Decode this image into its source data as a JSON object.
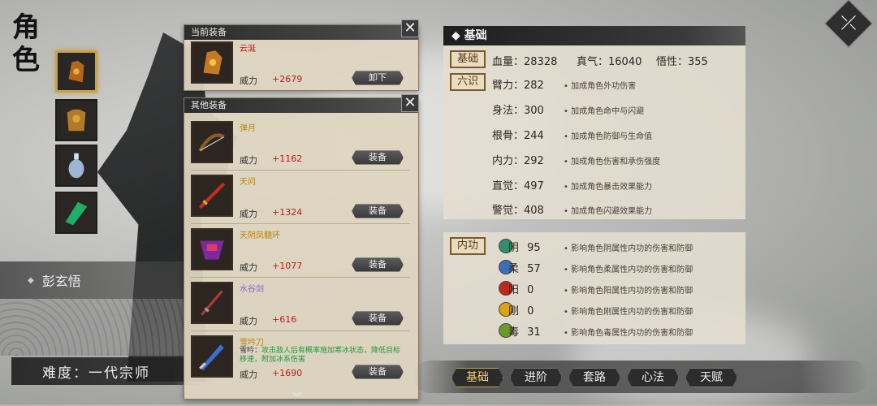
{
  "page": {
    "title": "角色"
  },
  "character": {
    "name": "彭玄悟",
    "difficulty": "难度：一代宗师"
  },
  "equip_slots": [
    {
      "name": "gauntlet",
      "selected": true
    },
    {
      "name": "armor",
      "selected": false
    },
    {
      "name": "pendant",
      "selected": false
    },
    {
      "name": "jade",
      "selected": false
    }
  ],
  "current_equipment": {
    "header": "当前装备",
    "item": {
      "name": "云涎",
      "power_label": "威力",
      "power_value": "+2679",
      "button": "卸下"
    }
  },
  "other_equipment": {
    "header": "其他装备",
    "items": [
      {
        "name": "弹月",
        "power_label": "威力",
        "power_value": "+1162",
        "button": "装备",
        "name_color": "#b8860b"
      },
      {
        "name": "天问",
        "power_label": "威力",
        "power_value": "+1324",
        "button": "装备",
        "name_color": "#b8860b"
      },
      {
        "name": "天阴凤髓环",
        "power_label": "威力",
        "power_value": "+1077",
        "button": "装备",
        "name_color": "#b8860b"
      },
      {
        "name": "水谷剑",
        "power_label": "威力",
        "power_value": "+616",
        "button": "装备",
        "name_color": "#8a5ad6"
      },
      {
        "name": "雪吟刀",
        "power_label": "威力",
        "power_value": "+1690",
        "button": "装备",
        "name_color": "#b8860b",
        "desc_prefix": "雪吟：",
        "desc": "攻击敌人后有概率施加寒冰状态，降低目标移速，附加冰系伤害"
      }
    ]
  },
  "stats": {
    "header": "基础",
    "tag_basic": "基础",
    "tag_six": "六识",
    "hp_label": "血量：",
    "hp_value": "28328",
    "qi_label": "真气：",
    "qi_value": "16040",
    "wux_label": "悟性：",
    "wux_value": "355",
    "rows": [
      {
        "label": "臂力：",
        "value": "282",
        "desc": "加成角色外功伤害"
      },
      {
        "label": "身法：",
        "value": "300",
        "desc": "加成角色命中与闪避"
      },
      {
        "label": "根骨：",
        "value": "244",
        "desc": "加成角色防御与生命值"
      },
      {
        "label": "内力：",
        "value": "292",
        "desc": "加成角色伤害和承伤强度"
      },
      {
        "label": "直觉：",
        "value": "497",
        "desc": "加成角色暴击效果能力"
      },
      {
        "label": "警觉：",
        "value": "408",
        "desc": "加成角色闪避效果能力"
      }
    ]
  },
  "neigong": {
    "tag": "内功",
    "rows": [
      {
        "char": "阴",
        "value": "95",
        "desc": "影响角色阴属性内功的伤害和防御",
        "color": "#2f8f6a"
      },
      {
        "char": "柔",
        "value": "57",
        "desc": "影响角色柔属性内功的伤害和防御",
        "color": "#3a6fb8"
      },
      {
        "char": "阳",
        "value": "0",
        "desc": "影响角色阳属性内功的伤害和防御",
        "color": "#c0281e"
      },
      {
        "char": "刚",
        "value": "0",
        "desc": "影响角色刚属性内功的伤害和防御",
        "color": "#d9a514"
      },
      {
        "char": "毒",
        "value": "31",
        "desc": "影响角色毒属性内功的伤害和防御",
        "color": "#6a9a2a"
      }
    ]
  },
  "tabs": [
    {
      "label": "基础",
      "active": true
    },
    {
      "label": "进阶",
      "active": false
    },
    {
      "label": "套路",
      "active": false
    },
    {
      "label": "心法",
      "active": false
    },
    {
      "label": "天赋",
      "active": false
    }
  ],
  "close_label": "✕"
}
